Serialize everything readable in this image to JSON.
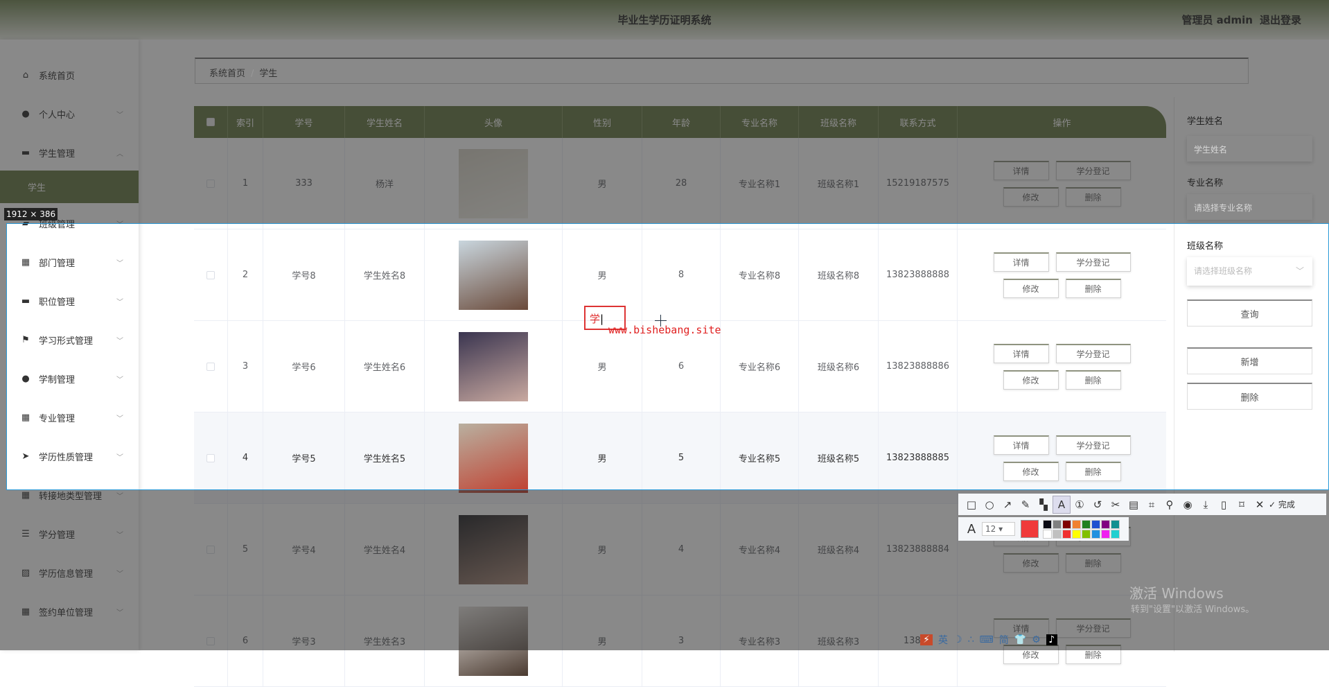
{
  "header": {
    "title": "毕业生学历证明系统",
    "user": "管理员 admin",
    "logout": "退出登录"
  },
  "sidebar": {
    "items": [
      {
        "label": "系统首页",
        "icon": "home-icon",
        "chev": ""
      },
      {
        "label": "个人中心",
        "icon": "user-icon",
        "chev": "﹀"
      },
      {
        "label": "学生管理",
        "icon": "monitor-icon",
        "chev": "︿"
      },
      {
        "label": "学生",
        "icon": "",
        "chev": "",
        "active": true
      },
      {
        "label": "班级管理",
        "icon": "chat-icon",
        "chev": "﹀"
      },
      {
        "label": "部门管理",
        "icon": "grid-icon",
        "chev": "﹀"
      },
      {
        "label": "职位管理",
        "icon": "monitor-icon",
        "chev": "﹀"
      },
      {
        "label": "学习形式管理",
        "icon": "flag-icon",
        "chev": "﹀"
      },
      {
        "label": "学制管理",
        "icon": "user-icon",
        "chev": "﹀"
      },
      {
        "label": "专业管理",
        "icon": "grid-icon",
        "chev": "﹀"
      },
      {
        "label": "学历性质管理",
        "icon": "send-icon",
        "chev": "﹀"
      },
      {
        "label": "转接地类型管理",
        "icon": "grid-icon",
        "chev": "﹀"
      },
      {
        "label": "学分管理",
        "icon": "list-icon",
        "chev": "﹀"
      },
      {
        "label": "学历信息管理",
        "icon": "chart-icon",
        "chev": "﹀"
      },
      {
        "label": "签约单位管理",
        "icon": "grid-icon",
        "chev": "﹀"
      }
    ]
  },
  "breadcrumb": {
    "home": "系统首页",
    "sep": "/",
    "current": "学生"
  },
  "table": {
    "columns": [
      "索引",
      "学号",
      "学生姓名",
      "头像",
      "性别",
      "年龄",
      "专业名称",
      "班级名称",
      "联系方式",
      "操作"
    ],
    "actions": {
      "detail": "详情",
      "credit": "学分登记",
      "edit": "修改",
      "delete": "删除"
    },
    "rows": [
      {
        "index": "1",
        "no": "333",
        "name": "杨洋",
        "gender": "男",
        "age": "28",
        "major": "专业名称1",
        "class": "班级名称1",
        "phone": "15219187575",
        "img": [
          "#d8d4c8",
          "#f1efe8"
        ]
      },
      {
        "index": "2",
        "no": "学号8",
        "name": "学生姓名8",
        "gender": "男",
        "age": "8",
        "major": "专业名称8",
        "class": "班级名称8",
        "phone": "13823888888",
        "img": [
          "#c9d6de",
          "#6a4a3a"
        ]
      },
      {
        "index": "3",
        "no": "学号6",
        "name": "学生姓名6",
        "gender": "男",
        "age": "6",
        "major": "专业名称6",
        "class": "班级名称6",
        "phone": "13823888886",
        "img": [
          "#3a3550",
          "#c9a9a0"
        ]
      },
      {
        "index": "4",
        "no": "学号5",
        "name": "学生姓名5",
        "gender": "男",
        "age": "5",
        "major": "专业名称5",
        "class": "班级名称5",
        "phone": "13823888885",
        "img": [
          "#b9b0a0",
          "#c04030"
        ]
      },
      {
        "index": "5",
        "no": "学号4",
        "name": "学生姓名4",
        "gender": "男",
        "age": "4",
        "major": "专业名称4",
        "class": "班级名称4",
        "phone": "13823888884",
        "img": [
          "#2a2a2e",
          "#b09080"
        ]
      },
      {
        "index": "6",
        "no": "学号3",
        "name": "学生姓名3",
        "gender": "男",
        "age": "3",
        "major": "专业名称3",
        "class": "班级名称3",
        "phone": "13823",
        "img": [
          "#e8e4e0",
          "#4a3a30"
        ]
      }
    ]
  },
  "filters": {
    "name_label": "学生姓名",
    "name_placeholder": "学生姓名",
    "major_label": "专业名称",
    "major_placeholder": "请选择专业名称",
    "class_label": "班级名称",
    "class_placeholder": "请选择班级名称",
    "search": "查询",
    "add": "新增",
    "delete": "删除"
  },
  "capture": {
    "size_label": "1912 × 386",
    "typed_text": "学",
    "watermark": "www.bishebang.site",
    "font_size": "12",
    "done": "完成",
    "current_color": "#f03a3a",
    "palette": [
      "#0a0a14",
      "#808080",
      "#800000",
      "#f08030",
      "#208020",
      "#2050d0",
      "#800080",
      "#109090",
      "#ffffff",
      "#c0c0c0",
      "#f03030",
      "#ffff00",
      "#80c000",
      "#2090e0",
      "#f020f0",
      "#20d0d0"
    ]
  },
  "windows": {
    "activate": "激活 Windows",
    "hint": "转到\"设置\"以激活 Windows。"
  },
  "ime": {
    "lang": "英",
    "mode": "简"
  }
}
